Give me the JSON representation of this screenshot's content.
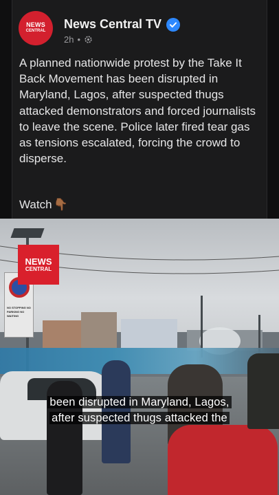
{
  "post": {
    "avatar_line1": "NEWS",
    "avatar_line2": "CENTRAL",
    "page_name": "News Central TV",
    "time_ago": "2h",
    "separator": "•",
    "body": "A planned nationwide protest by the Take It Back Movement has been disrupted in Maryland, Lagos, after suspected thugs attacked demonstrators and forced journalists to leave the scene. Police later fired tear gas as tensions escalated, forcing the crowd to disperse.",
    "watch_label": "Watch",
    "watch_emoji": "👇🏾"
  },
  "video": {
    "logo_line1": "NEWS",
    "logo_line2": "CENTRAL",
    "sign_text": "NO STOPPING NO PARKING NO WAITING",
    "caption_line1": "been disrupted in Maryland, Lagos,",
    "caption_line2": "after suspected thugs attacked the"
  },
  "colors": {
    "background": "#0f0f10",
    "card": "#1b1b1c",
    "brand_red": "#d3202e",
    "verified_blue": "#2d88ff",
    "meta_gray": "#9a9a9d"
  },
  "icons": {
    "verified": "verified-badge-icon",
    "audience": "gear-icon"
  }
}
